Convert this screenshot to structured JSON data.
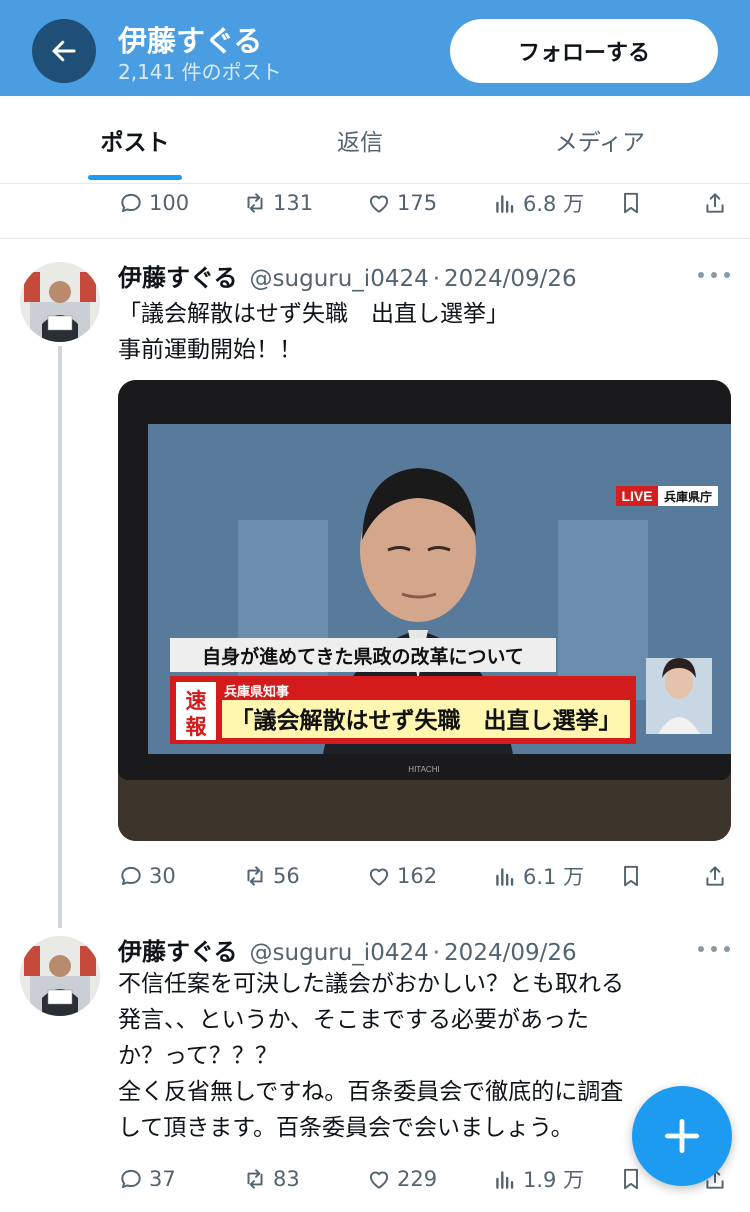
{
  "header": {
    "name": "伊藤すぐる",
    "post_count": "2,141 件のポスト",
    "follow_label": "フォローする",
    "back_icon": "arrow-left-icon",
    "bg_color": "#4a9de0"
  },
  "tabs": [
    {
      "label": "ポスト",
      "active": true
    },
    {
      "label": "返信",
      "active": false
    },
    {
      "label": "メディア",
      "active": false
    }
  ],
  "top_actions": {
    "replies": "100",
    "reposts": "131",
    "likes": "175",
    "views": "6.8 万"
  },
  "posts": [
    {
      "author": "伊藤すぐる",
      "handle": "@suguru_i0424",
      "separator": "·",
      "date": "2024/09/26",
      "text": "「議会解散はせず失職　出直し選挙」\n事前運動開始！！",
      "media": {
        "tv_corner_label": "LIVE",
        "tv_location": "兵庫県庁",
        "subtitle": "自身が進めてきた県政の改革について",
        "breaking_tag_1": "速",
        "breaking_tag_2": "報",
        "breaking_header": "兵庫県知事",
        "breaking_main": "「議会解散はせず失職　出直し選挙」",
        "tv_brand": "HITACHI"
      },
      "actions": {
        "replies": "30",
        "reposts": "56",
        "likes": "162",
        "views": "6.1 万"
      }
    },
    {
      "author": "伊藤すぐる",
      "handle": "@suguru_i0424",
      "separator": "·",
      "date": "2024/09/26",
      "text": "不信任案を可決した議会がおかしい？とも取れる\n発言、、というか、そこまでする必要があった\nか？って？？？\n全く反省無しですね。百条委員会で徹底的に調査\nして頂きます。百条委員会で会いましょう。",
      "actions": {
        "replies": "37",
        "reposts": "83",
        "likes": "229",
        "views": "1.9 万"
      }
    }
  ],
  "fab": {
    "icon": "compose-plus-icon",
    "color": "#1d9bf0"
  }
}
